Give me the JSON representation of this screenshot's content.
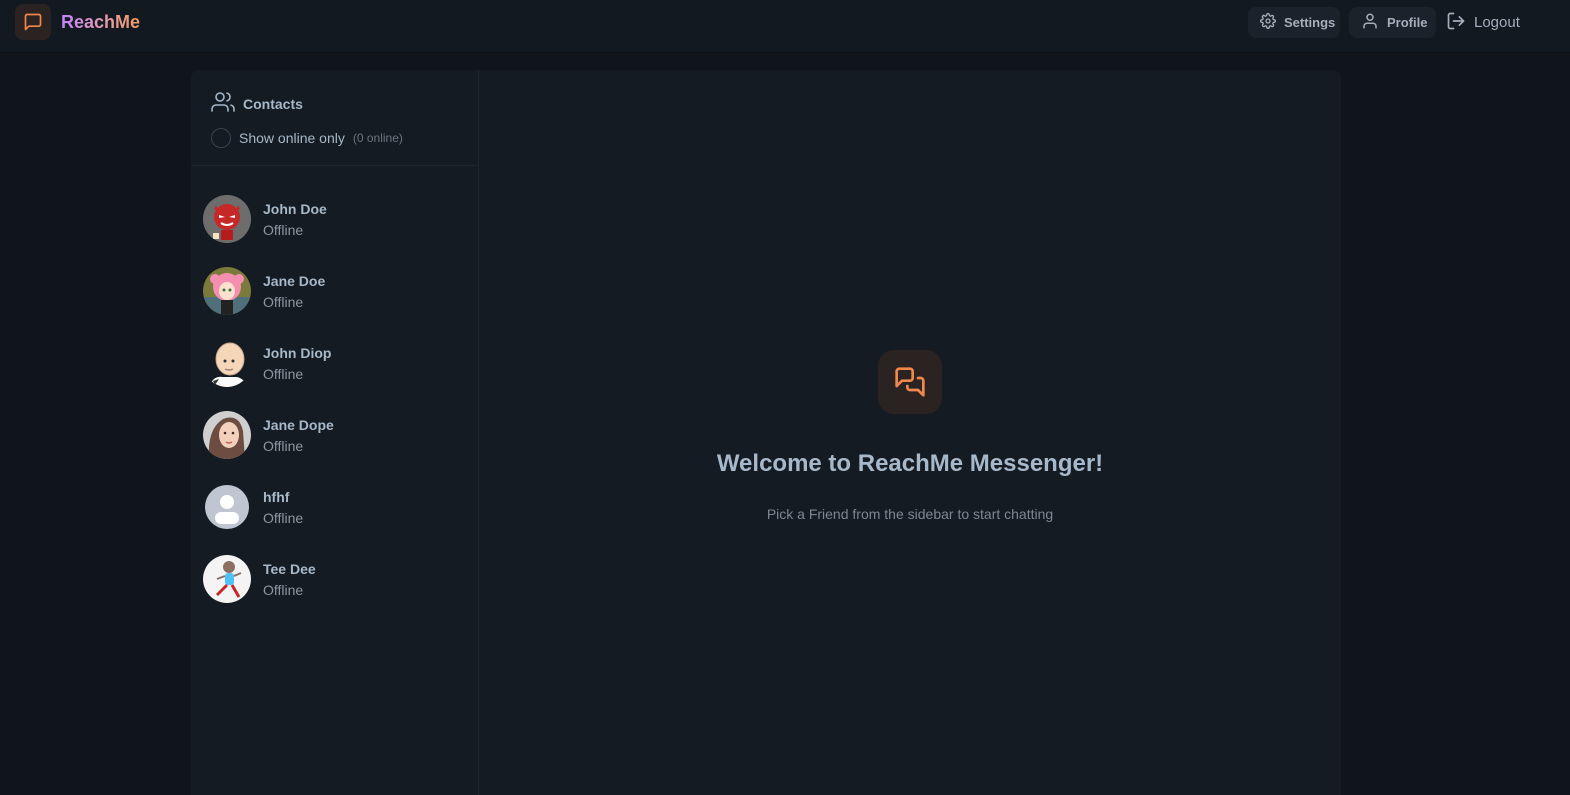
{
  "app": {
    "name": "ReachMe",
    "colors": {
      "accent": "#f0884e",
      "background": "#0f151b",
      "panel": "#141b22"
    }
  },
  "nav": {
    "settings_label": "Settings",
    "profile_label": "Profile",
    "logout_label": "Logout"
  },
  "sidebar": {
    "title": "Contacts",
    "online_toggle_label": "Show online only",
    "online_count": "(0 online)",
    "contacts": [
      {
        "name": "John Doe",
        "status": "Offline",
        "avatar": "red-devil-avatar"
      },
      {
        "name": "Jane Doe",
        "status": "Offline",
        "avatar": "pink-hair-anime-avatar"
      },
      {
        "name": "John Diop",
        "status": "Offline",
        "avatar": "bald-cartoon-avatar"
      },
      {
        "name": "Jane Dope",
        "status": "Offline",
        "avatar": "woman-photo-avatar"
      },
      {
        "name": "hfhf",
        "status": "Offline",
        "avatar": "default-user-avatar"
      },
      {
        "name": "Tee Dee",
        "status": "Offline",
        "avatar": "running-kid-avatar"
      }
    ]
  },
  "welcome": {
    "title": "Welcome to ReachMe Messenger!",
    "subtitle": "Pick a Friend from the sidebar to start chatting"
  }
}
